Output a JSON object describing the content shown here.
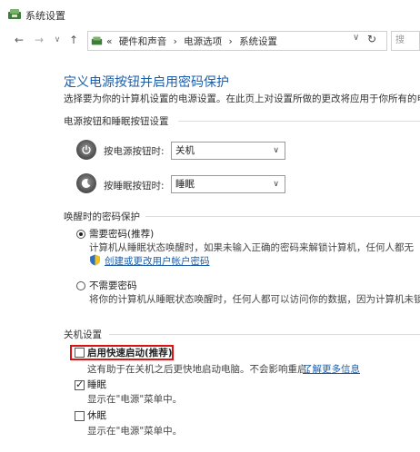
{
  "window": {
    "title": "系统设置"
  },
  "address": {
    "prefix": "«",
    "crumbs": [
      "硬件和声音",
      "›",
      "电源选项",
      "›",
      "系统设置"
    ],
    "dropdown_icon": "chevron-down-icon",
    "refresh_icon": "refresh-icon",
    "search_placeholder": "搜"
  },
  "nav": {
    "back": "←",
    "forward": "→",
    "recent": "∨",
    "up": "↑"
  },
  "main": {
    "heading": "定义电源按钮并启用密码保护",
    "description": "选择要为你的计算机设置的电源设置。在此页上对设置所做的更改将应用于你所有的电"
  },
  "buttons_section": {
    "title": "电源按钮和睡眠按钮设置",
    "power_label": "按电源按钮时:",
    "power_value": "关机",
    "sleep_label": "按睡眠按钮时:",
    "sleep_value": "睡眠"
  },
  "password_section": {
    "title": "唤醒时的密码保护",
    "option1_label": "需要密码(推荐)",
    "option1_desc": "计算机从睡眠状态唤醒时，如果未输入正确的密码来解锁计算机，任何人都无",
    "option1_link": "创建或更改用户帐户密码",
    "option2_label": "不需要密码",
    "option2_desc": "将你的计算机从睡眠状态唤醒时，任何人都可以访问你的数据，因为计算机未锁"
  },
  "shutdown_section": {
    "title": "关机设置",
    "fast_startup_label": "启用快速启动(推荐)",
    "fast_startup_desc": "这有助于在关机之后更快地启动电脑。不会影响重启。",
    "fast_startup_link": "了解更多信息",
    "sleep_label": "睡眠",
    "sleep_desc": "显示在\"电源\"菜单中。",
    "hibernate_label": "休眠",
    "hibernate_desc": "显示在\"电源\"菜单中。"
  },
  "colors": {
    "heading": "#1e5ea8",
    "highlight": "#dd1111",
    "link": "#1e5ea8"
  }
}
